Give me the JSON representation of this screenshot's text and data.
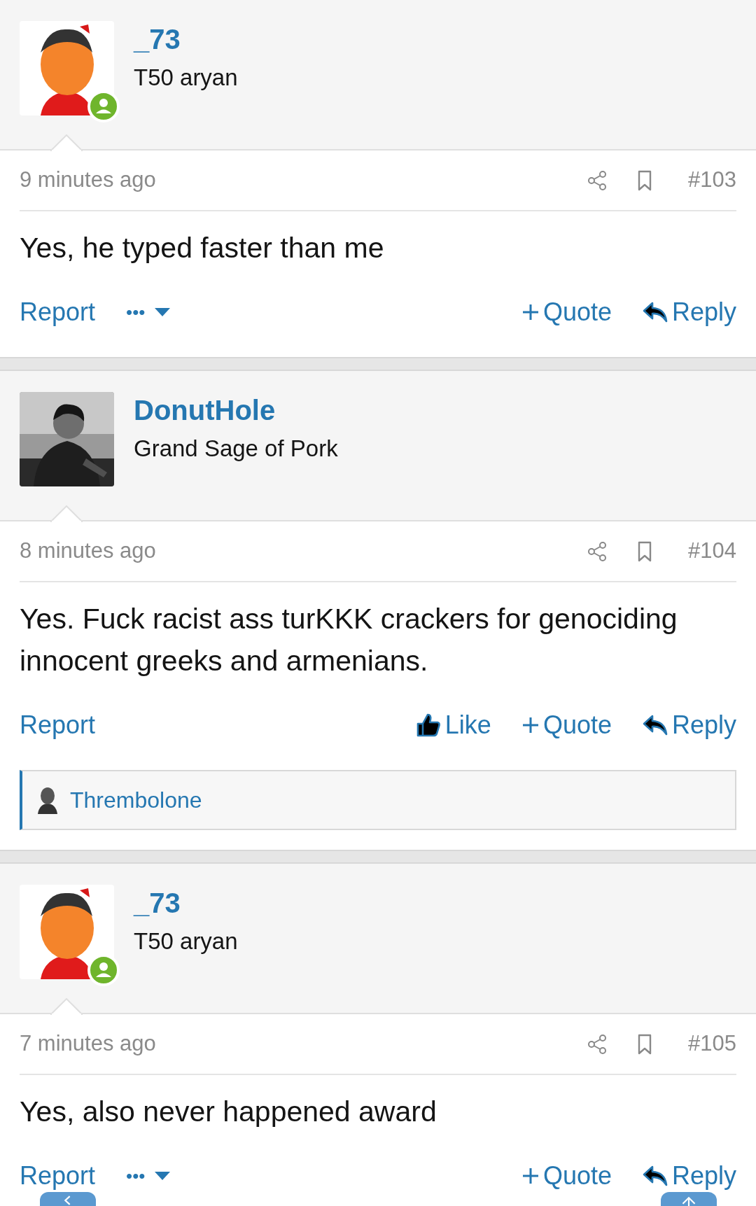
{
  "posts": [
    {
      "author": "_73",
      "user_title": "T50 aryan",
      "online": true,
      "time": "9 minutes ago",
      "number": "#103",
      "paragraphs": [
        "Yes, he typed faster than me"
      ],
      "actions": [
        {
          "kind": "report",
          "label": "Report"
        },
        {
          "kind": "more",
          "label": "•••"
        },
        {
          "kind": "quote",
          "label": "Quote"
        },
        {
          "kind": "reply",
          "label": "Reply"
        }
      ]
    },
    {
      "author": "DonutHole",
      "user_title": "Grand Sage of Pork",
      "online": false,
      "time": "8 minutes ago",
      "number": "#104",
      "paragraphs": [
        "Yes. Fuck racist ass turKKK crackers for genociding innocent greeks and armenians."
      ],
      "actions": [
        {
          "kind": "report",
          "label": "Report"
        },
        {
          "kind": "like",
          "label": "Like"
        },
        {
          "kind": "quote",
          "label": "Quote"
        },
        {
          "kind": "reply",
          "label": "Reply"
        }
      ],
      "reactions": {
        "user": "Thrembolone"
      }
    },
    {
      "author": "_73",
      "user_title": "T50 aryan",
      "online": true,
      "time": "7 minutes ago",
      "number": "#105",
      "paragraphs": [
        "Yes, also never happened award"
      ],
      "actions": [
        {
          "kind": "report",
          "label": "Report"
        },
        {
          "kind": "more",
          "label": "•••"
        },
        {
          "kind": "quote",
          "label": "Quote"
        },
        {
          "kind": "reply",
          "label": "Reply"
        }
      ]
    }
  ]
}
